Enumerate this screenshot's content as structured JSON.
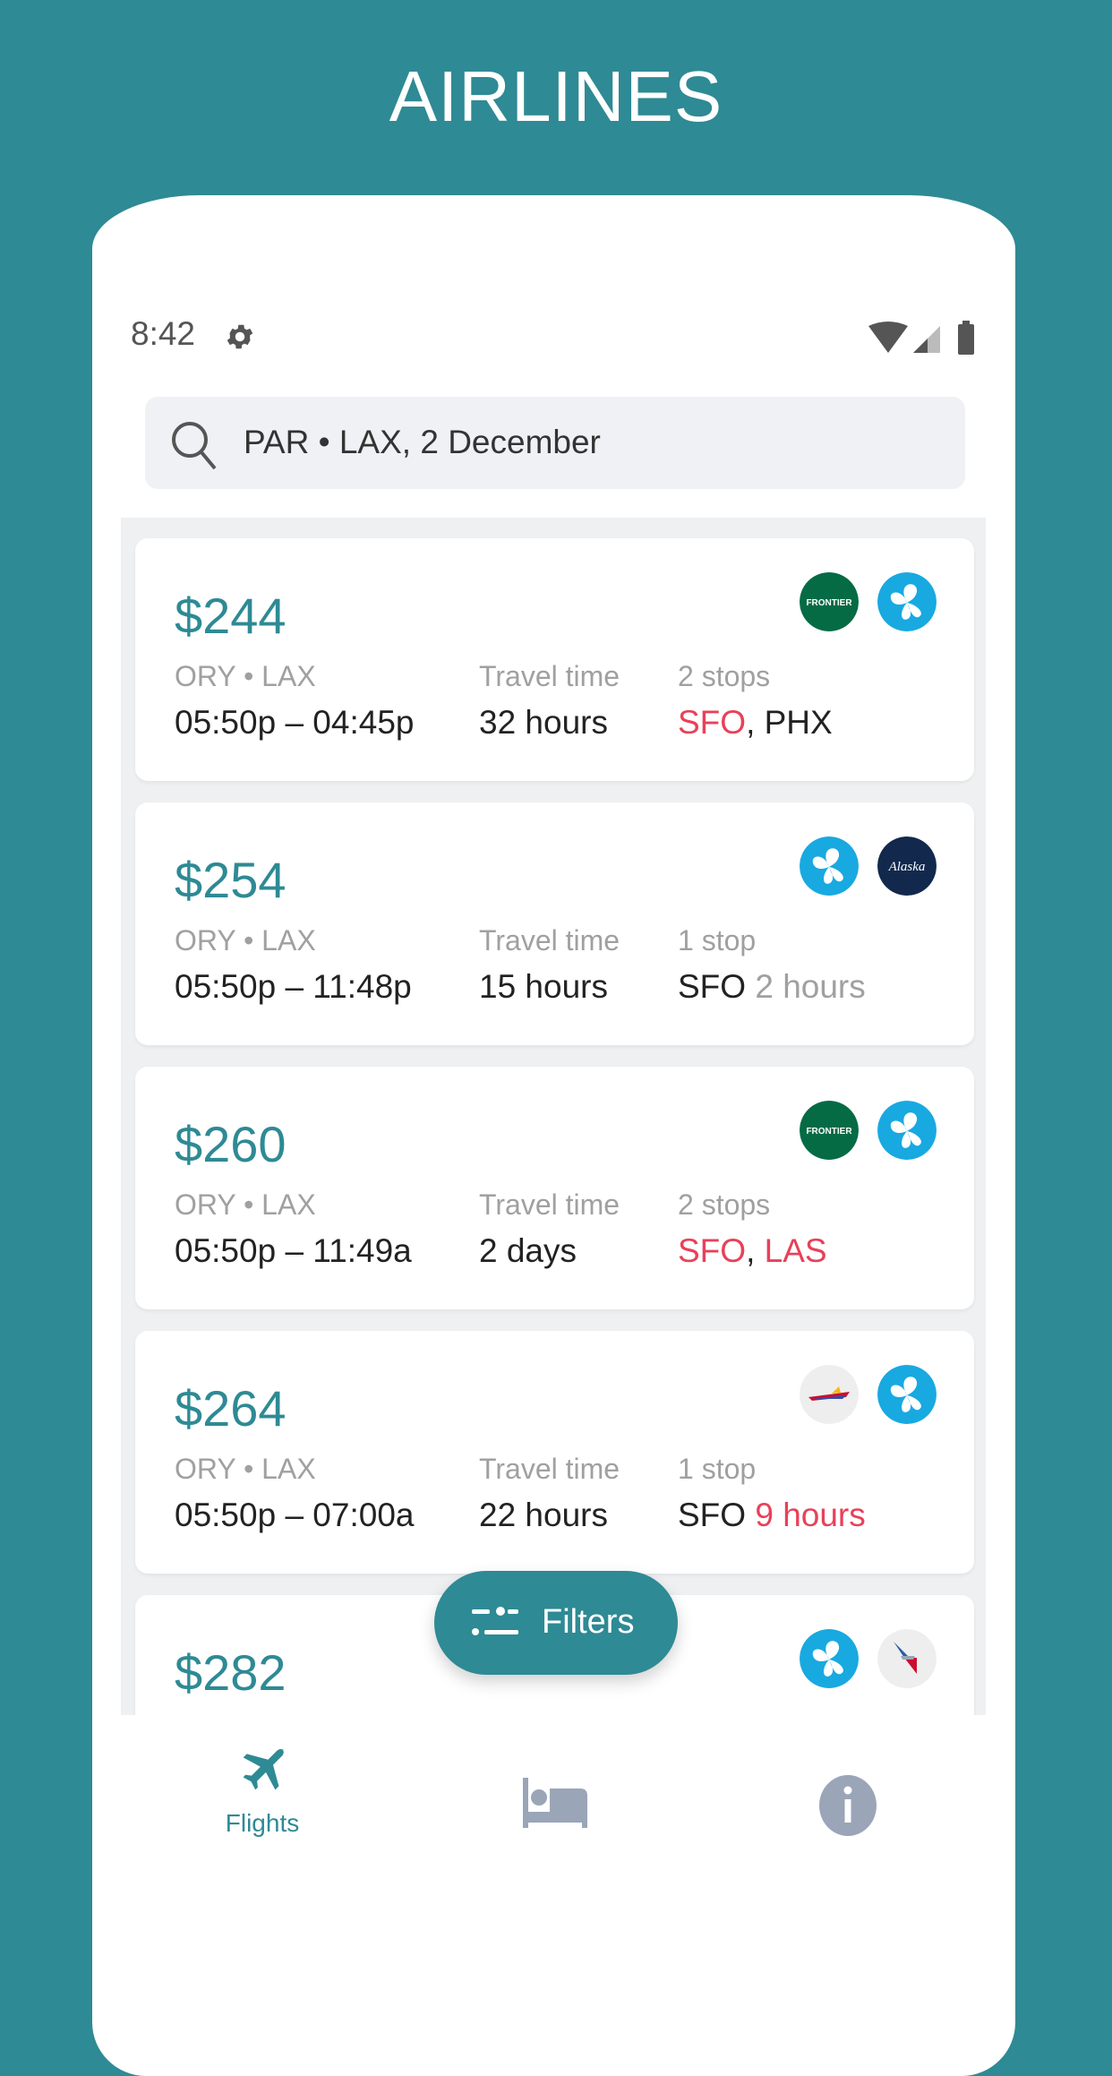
{
  "header": {
    "title": "AIRLINES"
  },
  "status_bar": {
    "time": "8:42",
    "icons": [
      "gear-icon",
      "wifi-icon",
      "signal-icon",
      "battery-icon"
    ]
  },
  "search": {
    "value": "PAR • LAX, 2 December",
    "icon": "search-icon"
  },
  "colors": {
    "accent": "#2e8a94",
    "alert": "#e8415a",
    "muted": "#a0a0a0"
  },
  "flights": [
    {
      "price": "$244",
      "airlines": [
        "Frontier",
        "Volaris"
      ],
      "route": "ORY • LAX",
      "times": "05:50p – 04:45p",
      "travel_label": "Travel time",
      "travel": "32 hours",
      "stops_label": "2 stops",
      "stops": [
        {
          "text": "SFO",
          "style": "red"
        },
        {
          "text": ", PHX",
          "style": "normal"
        }
      ]
    },
    {
      "price": "$254",
      "airlines": [
        "Volaris",
        "Alaska"
      ],
      "route": "ORY • LAX",
      "times": "05:50p – 11:48p",
      "travel_label": "Travel time",
      "travel": "15 hours",
      "stops_label": "1 stop",
      "stops": [
        {
          "text": "SFO ",
          "style": "normal"
        },
        {
          "text": "2 hours",
          "style": "gray"
        }
      ]
    },
    {
      "price": "$260",
      "airlines": [
        "Frontier",
        "Volaris"
      ],
      "route": "ORY • LAX",
      "times": "05:50p – 11:49a",
      "travel_label": "Travel time",
      "travel": "2 days",
      "stops_label": "2 stops",
      "stops": [
        {
          "text": "SFO",
          "style": "red"
        },
        {
          "text": ", ",
          "style": "normal"
        },
        {
          "text": "LAS",
          "style": "red"
        }
      ]
    },
    {
      "price": "$264",
      "airlines": [
        "Southwest",
        "Volaris"
      ],
      "route": "ORY • LAX",
      "times": "05:50p – 07:00a",
      "travel_label": "Travel time",
      "travel": "22 hours",
      "stops_label": "1 stop",
      "stops": [
        {
          "text": "SFO ",
          "style": "normal"
        },
        {
          "text": "9 hours",
          "style": "red"
        }
      ]
    },
    {
      "price": "$282",
      "airlines": [
        "Volaris",
        "American"
      ]
    }
  ],
  "logo_text": {
    "frontier": "FRONTIER",
    "alaska": "Alaska"
  },
  "filters_button": {
    "label": "Filters"
  },
  "bottom_nav": [
    {
      "label": "Flights",
      "icon": "airplane-icon",
      "active": true
    },
    {
      "label": "",
      "icon": "bed-icon"
    },
    {
      "label": "",
      "icon": "info-icon"
    }
  ]
}
